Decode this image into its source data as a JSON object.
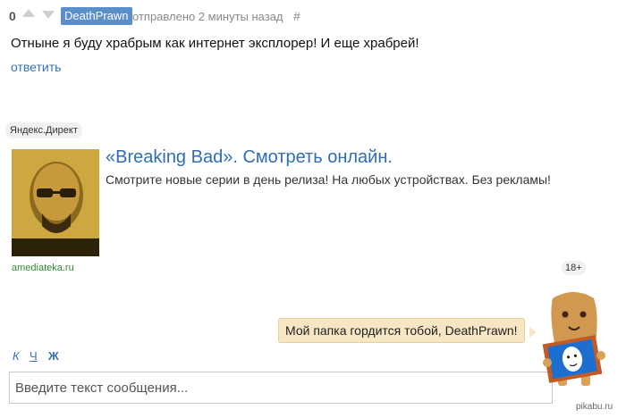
{
  "comment": {
    "rating": "0",
    "username": "DeathPrawn",
    "meta": "отправлено 2 минуты назад",
    "hash": "#",
    "text": "Отныне я буду храбрым как интернет эксплорер! И еще храбрей!",
    "reply_label": "ответить"
  },
  "ad": {
    "label": "Яндекс.Директ",
    "title": "«Breaking Bad». Смотреть онлайн.",
    "description": "Смотрите новые серии в день релиза! На любых устройствах. Без рекламы!",
    "domain": "amediateka.ru",
    "age_badge": "18+"
  },
  "mascot": {
    "speech": "Мой папка гордится тобой, DeathPrawn!"
  },
  "formatting": {
    "italic": "К",
    "underline": "Ч",
    "bold": "Ж"
  },
  "message_input": {
    "placeholder": "Введите текст сообщения..."
  },
  "watermark": "pikabu.ru",
  "colors": {
    "user_badge": "#5a8fc9",
    "link": "#3b70b0",
    "ad_title": "#2f6db3",
    "ad_domain": "#2f8a2f",
    "bubble": "#f7e6c4"
  }
}
